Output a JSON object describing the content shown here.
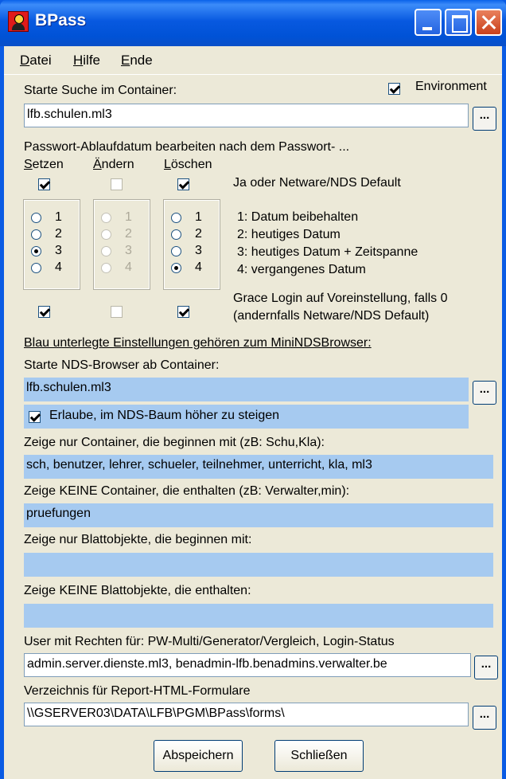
{
  "window": {
    "title": "BPass"
  },
  "menu": [
    "Datei",
    "Hilfe",
    "Ende"
  ],
  "container": {
    "label": "Starte Suche im Container:",
    "value": "lfb.schulen.ml3",
    "environment_label": "Environment",
    "environment_checked": true
  },
  "password": {
    "heading": "Passwort-Ablaufdatum bearbeiten nach dem Passwort- ...",
    "col_setzen": "Setzen",
    "col_andern": "Ändern",
    "col_loeschen": "Löschen",
    "default_label": "Ja oder Netware/NDS Default",
    "radio_values": [
      "1",
      "2",
      "3",
      "4"
    ],
    "setzen_selected": 3,
    "andern_selected": 0,
    "loeschen_selected": 4,
    "legend": [
      "1: Datum beibehalten",
      "2: heutiges Datum",
      "3: heutiges Datum + Zeitspanne",
      "4: vergangenes Datum"
    ],
    "grace_line1": "Grace Login auf Voreinstellung, falls 0",
    "grace_line2": "(andernfalls Netware/NDS Default)"
  },
  "blue_note": "Blau unterlegte Einstellungen gehören zum MiniNDSBrowser:",
  "nds_browser": {
    "label": "Starte NDS-Browser ab Container:",
    "value": "lfb.schulen.ml3",
    "climb_label": "Erlaube, im NDS-Baum höher zu steigen"
  },
  "show_containers": {
    "label": "Zeige nur Container, die beginnen mit (zB: Schu,Kla):",
    "value": "sch, benutzer, lehrer, schueler, teilnehmer, unterricht, kla, ml3"
  },
  "hide_containers": {
    "label": "Zeige KEINE Container, die enthalten (zB: Verwalter,min):",
    "value": "pruefungen"
  },
  "show_leaves": {
    "label": "Zeige nur Blattobjekte, die beginnen mit:",
    "value": ""
  },
  "hide_leaves": {
    "label": "Zeige KEINE Blattobjekte, die enthalten:",
    "value": ""
  },
  "users": {
    "label": "User mit Rechten für: PW-Multi/Generator/Vergleich, Login-Status",
    "value": "admin.server.dienste.ml3, benadmin-lfb.benadmins.verwalter.be"
  },
  "report": {
    "label": "Verzeichnis für Report-HTML-Formulare",
    "value": "\\\\GSERVER03\\DATA\\LFB\\PGM\\BPass\\forms\\"
  },
  "browse_label": "...",
  "buttons": {
    "save": "Abspeichern",
    "close": "Schließen"
  }
}
